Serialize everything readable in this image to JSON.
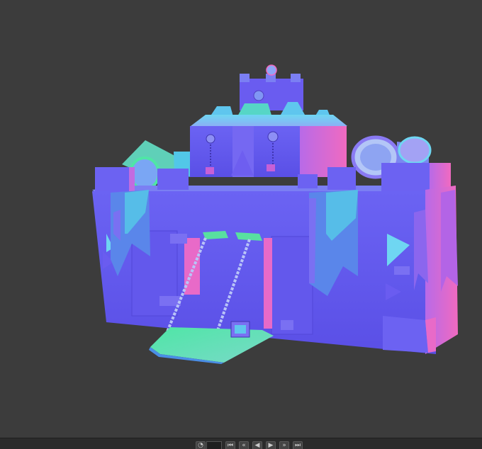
{
  "viewport": {
    "preview_mode": "normal-map",
    "background_color": "#3c3c3c",
    "model_name_icon": "castle-model"
  },
  "timeline": {
    "buttons": [
      {
        "icon": "time-picker-icon",
        "glyph": "◔"
      },
      {
        "icon": "skip-to-start-icon",
        "glyph": "⏮"
      },
      {
        "icon": "previous-key-icon",
        "glyph": "«"
      },
      {
        "icon": "step-back-icon",
        "glyph": "◀"
      },
      {
        "icon": "play-icon",
        "glyph": "▶"
      },
      {
        "icon": "next-key-icon",
        "glyph": "»"
      },
      {
        "icon": "skip-to-end-icon",
        "glyph": "⏭"
      }
    ]
  },
  "colors": {
    "normal_blue": "#6a5cf0",
    "normal_pink": "#e85ec4",
    "normal_green": "#58e0a0",
    "normal_cyan": "#5ec8f0",
    "normal_violet": "#8a6af5"
  }
}
